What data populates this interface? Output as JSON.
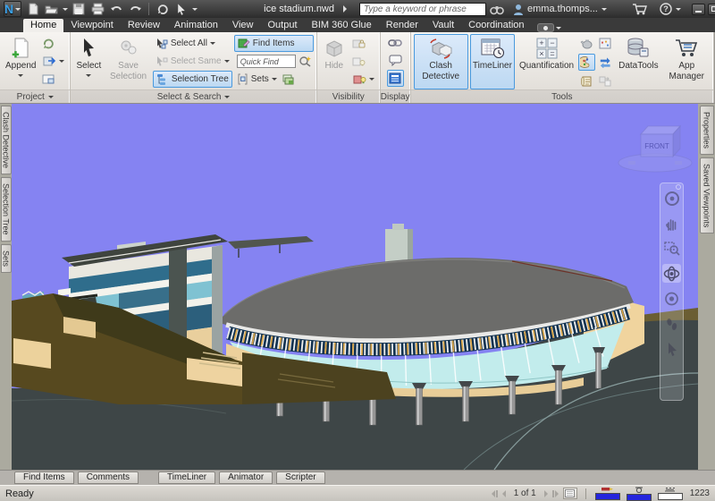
{
  "colors": {
    "sky": "#8583f2",
    "accent": "#4a9ade",
    "toggle_bg": "#cfe3f6",
    "titlebar_dark": "#2c2c2c"
  },
  "titlebar": {
    "title": "ice stadium.nwd",
    "search_placeholder": "Type a keyword or phrase",
    "user": "emma.thomps..."
  },
  "ribbon_tabs": [
    {
      "label": "Home",
      "active": true
    },
    {
      "label": "Viewpoint"
    },
    {
      "label": "Review"
    },
    {
      "label": "Animation"
    },
    {
      "label": "View"
    },
    {
      "label": "Output"
    },
    {
      "label": "BIM 360 Glue"
    },
    {
      "label": "Render"
    },
    {
      "label": "Vault"
    },
    {
      "label": "Coordination"
    }
  ],
  "ribbon": {
    "project": {
      "label": "Project",
      "append": "Append"
    },
    "select_search": {
      "label": "Select & Search",
      "select": "Select",
      "save_selection": "Save Selection",
      "select_all": "Select All",
      "select_same": "Select Same",
      "selection_tree": "Selection Tree",
      "find_items": "Find Items",
      "quick_find_placeholder": "Quick Find",
      "sets": "Sets"
    },
    "visibility": {
      "label": "Visibility",
      "hide": "Hide"
    },
    "display": {
      "label": "Display"
    },
    "tools": {
      "label": "Tools",
      "clash_detective": "Clash Detective",
      "timeliner": "TimeLiner",
      "quantification": "Quantification",
      "datatools": "DataTools",
      "app_manager": "App Manager"
    }
  },
  "panels": {
    "left": [
      "Clash Detective",
      "Selection Tree",
      "Sets"
    ],
    "right": [
      "Properties",
      "Saved Viewpoints"
    ],
    "bottom": [
      "Find Items",
      "Comments",
      "TimeLiner",
      "Animator",
      "Scripter"
    ]
  },
  "viewport": {
    "viewcube_front": "FRONT"
  },
  "statusbar": {
    "ready": "Ready",
    "page": "1 of 1",
    "memory": "1223"
  }
}
